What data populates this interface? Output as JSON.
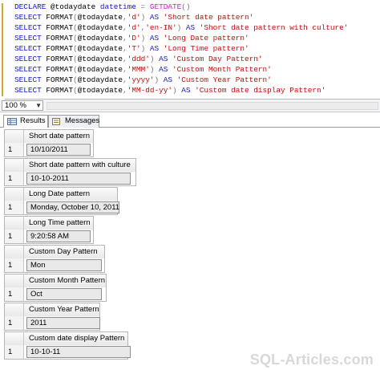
{
  "editor": {
    "lines": [
      [
        {
          "t": "kw",
          "v": "DECLARE "
        },
        {
          "t": "tx",
          "v": "@todaydate "
        },
        {
          "t": "kw",
          "v": "datetime "
        },
        {
          "t": "gr",
          "v": "= "
        },
        {
          "t": "fn",
          "v": "GETDATE"
        },
        {
          "t": "gr",
          "v": "()"
        }
      ],
      [
        {
          "t": "kw",
          "v": "SELECT "
        },
        {
          "t": "tx",
          "v": "FORMAT"
        },
        {
          "t": "gr",
          "v": "("
        },
        {
          "t": "tx",
          "v": "@todaydate"
        },
        {
          "t": "gr",
          "v": ","
        },
        {
          "t": "str",
          "v": "'d'"
        },
        {
          "t": "gr",
          "v": ") "
        },
        {
          "t": "kw",
          "v": "AS "
        },
        {
          "t": "str",
          "v": "'Short date pattern'"
        }
      ],
      [
        {
          "t": "kw",
          "v": "SELECT "
        },
        {
          "t": "tx",
          "v": "FORMAT"
        },
        {
          "t": "gr",
          "v": "("
        },
        {
          "t": "tx",
          "v": "@todaydate"
        },
        {
          "t": "gr",
          "v": ","
        },
        {
          "t": "str",
          "v": "'d'"
        },
        {
          "t": "gr",
          "v": ","
        },
        {
          "t": "str",
          "v": "'en-IN'"
        },
        {
          "t": "gr",
          "v": ") "
        },
        {
          "t": "kw",
          "v": "AS "
        },
        {
          "t": "str",
          "v": "'Short date pattern with culture'"
        }
      ],
      [
        {
          "t": "kw",
          "v": "SELECT "
        },
        {
          "t": "tx",
          "v": "FORMAT"
        },
        {
          "t": "gr",
          "v": "("
        },
        {
          "t": "tx",
          "v": "@todaydate"
        },
        {
          "t": "gr",
          "v": ","
        },
        {
          "t": "str",
          "v": "'D'"
        },
        {
          "t": "gr",
          "v": ") "
        },
        {
          "t": "kw",
          "v": "AS "
        },
        {
          "t": "str",
          "v": "'Long Date pattern'"
        }
      ],
      [
        {
          "t": "kw",
          "v": "SELECT "
        },
        {
          "t": "tx",
          "v": "FORMAT"
        },
        {
          "t": "gr",
          "v": "("
        },
        {
          "t": "tx",
          "v": "@todaydate"
        },
        {
          "t": "gr",
          "v": ","
        },
        {
          "t": "str",
          "v": "'T'"
        },
        {
          "t": "gr",
          "v": ") "
        },
        {
          "t": "kw",
          "v": "AS "
        },
        {
          "t": "str",
          "v": "'Long Time pattern'"
        }
      ],
      [
        {
          "t": "kw",
          "v": "SELECT "
        },
        {
          "t": "tx",
          "v": "FORMAT"
        },
        {
          "t": "gr",
          "v": "("
        },
        {
          "t": "tx",
          "v": "@todaydate"
        },
        {
          "t": "gr",
          "v": ","
        },
        {
          "t": "str",
          "v": "'ddd'"
        },
        {
          "t": "gr",
          "v": ") "
        },
        {
          "t": "kw",
          "v": "AS "
        },
        {
          "t": "str",
          "v": "'Custom Day Pattern'"
        }
      ],
      [
        {
          "t": "kw",
          "v": "SELECT "
        },
        {
          "t": "tx",
          "v": "FORMAT"
        },
        {
          "t": "gr",
          "v": "("
        },
        {
          "t": "tx",
          "v": "@todaydate"
        },
        {
          "t": "gr",
          "v": ","
        },
        {
          "t": "str",
          "v": "'MMM'"
        },
        {
          "t": "gr",
          "v": ") "
        },
        {
          "t": "kw",
          "v": "AS "
        },
        {
          "t": "str",
          "v": "'Custom Month Pattern'"
        }
      ],
      [
        {
          "t": "kw",
          "v": "SELECT "
        },
        {
          "t": "tx",
          "v": "FORMAT"
        },
        {
          "t": "gr",
          "v": "("
        },
        {
          "t": "tx",
          "v": "@todaydate"
        },
        {
          "t": "gr",
          "v": ","
        },
        {
          "t": "str",
          "v": "'yyyy'"
        },
        {
          "t": "gr",
          "v": ") "
        },
        {
          "t": "kw",
          "v": "AS "
        },
        {
          "t": "str",
          "v": "'Custom Year Pattern'"
        }
      ],
      [
        {
          "t": "kw",
          "v": "SELECT "
        },
        {
          "t": "tx",
          "v": "FORMAT"
        },
        {
          "t": "gr",
          "v": "("
        },
        {
          "t": "tx",
          "v": "@todaydate"
        },
        {
          "t": "gr",
          "v": ","
        },
        {
          "t": "str",
          "v": "'MM-dd-yy'"
        },
        {
          "t": "gr",
          "v": ") "
        },
        {
          "t": "kw",
          "v": "AS "
        },
        {
          "t": "str",
          "v": "'Custom date display Pattern'"
        }
      ]
    ]
  },
  "zoom": {
    "value": "100 %"
  },
  "tabs": [
    {
      "label": "Results",
      "icon": "grid-icon",
      "active": true
    },
    {
      "label": "Messages",
      "icon": "messages-icon",
      "active": false
    }
  ],
  "results": [
    {
      "column": "Short date pattern",
      "row": "1",
      "value": "10/10/2011"
    },
    {
      "column": "Short date pattern with culture",
      "row": "1",
      "value": "10-10-2011"
    },
    {
      "column": "Long Date pattern",
      "row": "1",
      "value": "Monday, October 10, 2011"
    },
    {
      "column": "Long Time pattern",
      "row": "1",
      "value": "9:20:58 AM"
    },
    {
      "column": "Custom Day Pattern",
      "row": "1",
      "value": "Mon"
    },
    {
      "column": "Custom Month Pattern",
      "row": "1",
      "value": "Oct"
    },
    {
      "column": "Custom Year Pattern",
      "row": "1",
      "value": "2011"
    },
    {
      "column": "Custom date display Pattern",
      "row": "1",
      "value": "10-10-11"
    }
  ],
  "watermark": "SQL-Articles.com",
  "colors": {
    "keyword": "#1418c9",
    "string": "#d20a0a",
    "function": "#d71ad1",
    "operator": "#7a7a7a"
  }
}
